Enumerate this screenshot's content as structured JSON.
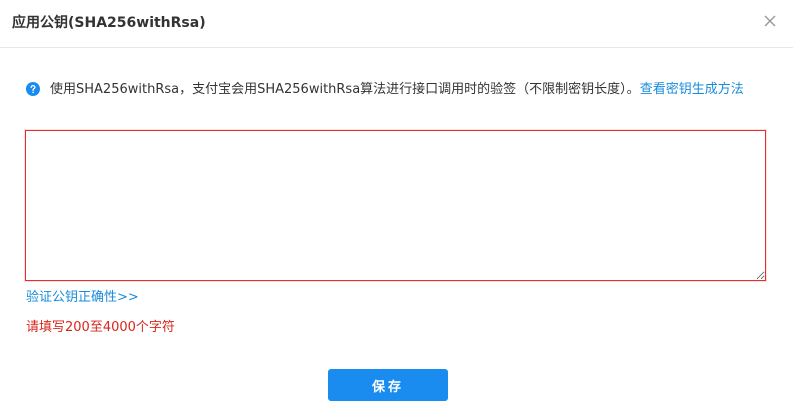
{
  "dialog": {
    "title": "应用公钥(SHA256withRsa)",
    "close_icon": "close-icon"
  },
  "info": {
    "icon": "help-circle-icon",
    "text": "使用SHA256withRsa，支付宝会用SHA256withRsa算法进行接口调用时的验签（不限制密钥长度）。",
    "link_text": "查看密钥生成方法"
  },
  "key_input": {
    "value": "",
    "placeholder": ""
  },
  "verify_link": "验证公钥正确性>>",
  "validation_error": "请填写200至4000个字符",
  "save_button_label": "保存",
  "colors": {
    "accent": "#1a8cef",
    "link": "#1a8cdb",
    "error": "#d9251c",
    "error_border": "#e52e2e"
  }
}
